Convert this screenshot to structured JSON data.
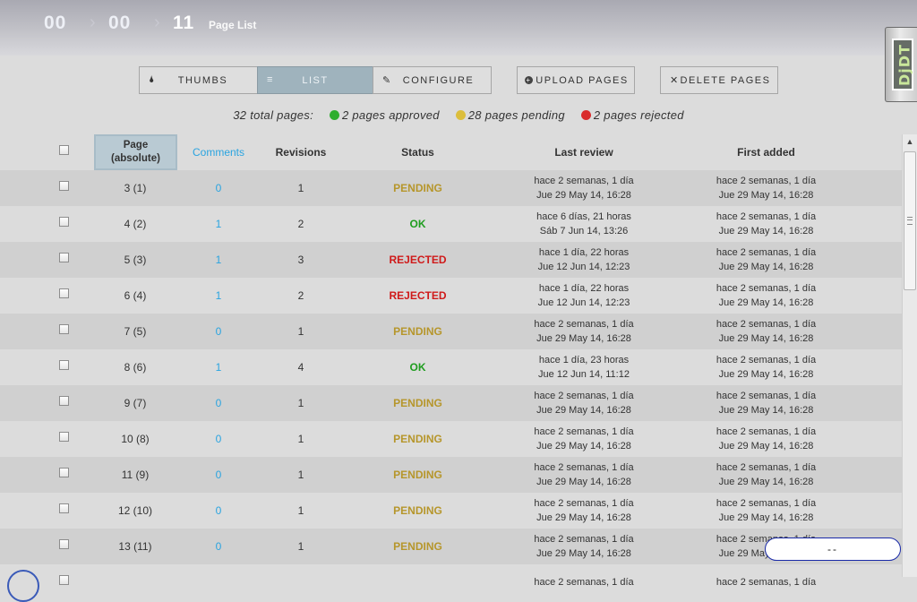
{
  "breadcrumb": {
    "items": [
      "00",
      "00",
      "11"
    ],
    "title": "Page List"
  },
  "logo_text": "DjDT",
  "toolbar": {
    "thumbs_label": "THUMBS",
    "list_label": "LIST",
    "configure_label": "CONFIGURE",
    "upload_label": "UPLOAD PAGES",
    "delete_label": "DELETE PAGES"
  },
  "summary": {
    "total": "32 total pages:",
    "approved": "2 pages approved",
    "pending": "28 pages pending",
    "rejected": "2 pages rejected",
    "colors": {
      "approved": "#2fae2f",
      "pending": "#dcbe3c",
      "rejected": "#d92b2b"
    }
  },
  "table": {
    "headers": {
      "page": "Page\n(absolute)",
      "comments": "Comments",
      "revisions": "Revisions",
      "status": "Status",
      "last_review": "Last review",
      "first_added": "First added"
    },
    "rows": [
      {
        "page": "3 (1)",
        "comments": "0",
        "revisions": "1",
        "status": "PENDING",
        "last_rel": "hace 2 semanas, 1 día",
        "last_date": "Jue 29 May 14, 16:28",
        "first_rel": "hace 2 semanas, 1 día",
        "first_date": "Jue 29 May 14, 16:28"
      },
      {
        "page": "4 (2)",
        "comments": "1",
        "revisions": "2",
        "status": "OK",
        "last_rel": "hace 6 días, 21 horas",
        "last_date": "Sáb 7 Jun 14, 13:26",
        "first_rel": "hace 2 semanas, 1 día",
        "first_date": "Jue 29 May 14, 16:28"
      },
      {
        "page": "5 (3)",
        "comments": "1",
        "revisions": "3",
        "status": "REJECTED",
        "last_rel": "hace 1 día, 22 horas",
        "last_date": "Jue 12 Jun 14, 12:23",
        "first_rel": "hace 2 semanas, 1 día",
        "first_date": "Jue 29 May 14, 16:28"
      },
      {
        "page": "6 (4)",
        "comments": "1",
        "revisions": "2",
        "status": "REJECTED",
        "last_rel": "hace 1 día, 22 horas",
        "last_date": "Jue 12 Jun 14, 12:23",
        "first_rel": "hace 2 semanas, 1 día",
        "first_date": "Jue 29 May 14, 16:28"
      },
      {
        "page": "7 (5)",
        "comments": "0",
        "revisions": "1",
        "status": "PENDING",
        "last_rel": "hace 2 semanas, 1 día",
        "last_date": "Jue 29 May 14, 16:28",
        "first_rel": "hace 2 semanas, 1 día",
        "first_date": "Jue 29 May 14, 16:28"
      },
      {
        "page": "8 (6)",
        "comments": "1",
        "revisions": "4",
        "status": "OK",
        "last_rel": "hace 1 día, 23 horas",
        "last_date": "Jue 12 Jun 14, 11:12",
        "first_rel": "hace 2 semanas, 1 día",
        "first_date": "Jue 29 May 14, 16:28"
      },
      {
        "page": "9 (7)",
        "comments": "0",
        "revisions": "1",
        "status": "PENDING",
        "last_rel": "hace 2 semanas, 1 día",
        "last_date": "Jue 29 May 14, 16:28",
        "first_rel": "hace 2 semanas, 1 día",
        "first_date": "Jue 29 May 14, 16:28"
      },
      {
        "page": "10 (8)",
        "comments": "0",
        "revisions": "1",
        "status": "PENDING",
        "last_rel": "hace 2 semanas, 1 día",
        "last_date": "Jue 29 May 14, 16:28",
        "first_rel": "hace 2 semanas, 1 día",
        "first_date": "Jue 29 May 14, 16:28"
      },
      {
        "page": "11 (9)",
        "comments": "0",
        "revisions": "1",
        "status": "PENDING",
        "last_rel": "hace 2 semanas, 1 día",
        "last_date": "Jue 29 May 14, 16:28",
        "first_rel": "hace 2 semanas, 1 día",
        "first_date": "Jue 29 May 14, 16:28"
      },
      {
        "page": "12 (10)",
        "comments": "0",
        "revisions": "1",
        "status": "PENDING",
        "last_rel": "hace 2 semanas, 1 día",
        "last_date": "Jue 29 May 14, 16:28",
        "first_rel": "hace 2 semanas, 1 día",
        "first_date": "Jue 29 May 14, 16:28"
      },
      {
        "page": "13 (11)",
        "comments": "0",
        "revisions": "1",
        "status": "PENDING",
        "last_rel": "hace 2 semanas, 1 día",
        "last_date": "Jue 29 May 14, 16:28",
        "first_rel": "hace 2 semanas, 1 día",
        "first_date": "Jue 29 May 14, 16:28"
      },
      {
        "page": "",
        "comments": "",
        "revisions": "",
        "status": "",
        "last_rel": "hace 2 semanas, 1 día",
        "last_date": "",
        "first_rel": "hace 2 semanas, 1 día",
        "first_date": ""
      }
    ]
  },
  "floating_pill": {
    "text": "--"
  }
}
